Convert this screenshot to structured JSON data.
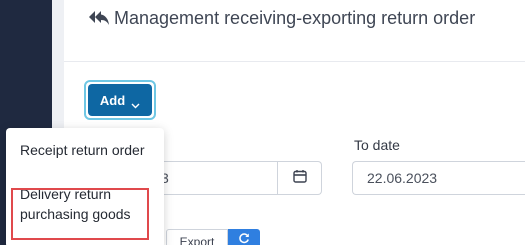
{
  "header": {
    "title": "Management receiving-exporting return order",
    "icon": "reply-all-icon"
  },
  "toolbar": {
    "add_label": "Add",
    "add_icon": "chevron-down-icon"
  },
  "add_menu": {
    "items": [
      {
        "label": "Receipt return order"
      },
      {
        "label": "Delivery return purchasing goods"
      }
    ],
    "highlighted_index": 1
  },
  "filters": {
    "from_date_value": "3",
    "to_date_label": "To date",
    "to_date_value": "22.06.2023",
    "calendar_icon": "calendar-icon"
  },
  "actions": {
    "export_label": "Export",
    "refresh_icon": "refresh-icon"
  },
  "colors": {
    "sidebar": "#1f2940",
    "primary": "#0e67a3",
    "focus_ring": "#6fc7e4",
    "refresh": "#2f7fe0",
    "highlight": "#e0494c"
  }
}
